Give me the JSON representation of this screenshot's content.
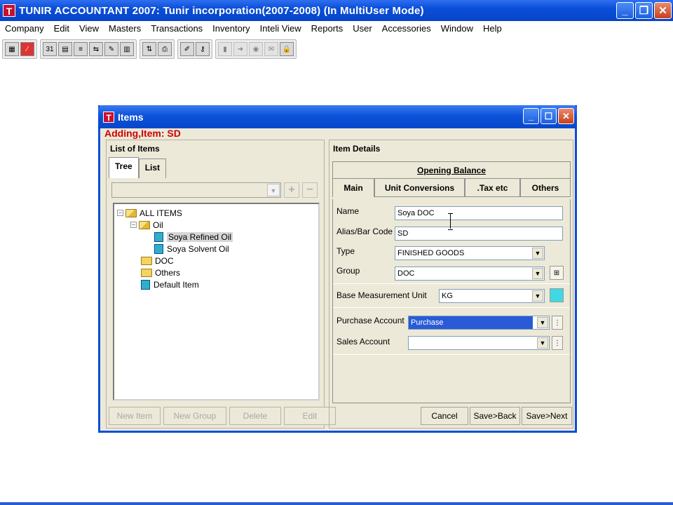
{
  "app": {
    "title": "TUNIR ACCOUNTANT 2007:  Tunir incorporation(2007-2008) (In MultiUser Mode)",
    "logo": "T"
  },
  "menu": [
    "Company",
    "Edit",
    "View",
    "Masters",
    "Transactions",
    "Inventory",
    "Inteli View",
    "Reports",
    "User",
    "Accessories",
    "Window",
    "Help"
  ],
  "dialog": {
    "title": "Items",
    "logo": "T",
    "status": "Adding,Item: SD",
    "left": {
      "title": "List of Items",
      "tabs": [
        "Tree",
        "List"
      ],
      "tree": [
        {
          "label": "ALL ITEMS",
          "icon": "folder-open-icon"
        },
        {
          "label": "Oil",
          "icon": "folder-open-icon"
        },
        {
          "label": "Soya Refined Oil",
          "icon": "item-icon",
          "selected": true
        },
        {
          "label": "Soya Solvent Oil",
          "icon": "item-icon"
        },
        {
          "label": "DOC",
          "icon": "folder-icon"
        },
        {
          "label": "Others",
          "icon": "folder-icon"
        },
        {
          "label": "Default Item",
          "icon": "item-icon"
        }
      ],
      "buttons": [
        "New Item",
        "New Group",
        "Delete",
        "Edit"
      ]
    },
    "right": {
      "title": "Item Details",
      "tabs_top": [
        "Opening Balance"
      ],
      "tabs": [
        "Main",
        "Unit Conversions",
        ".Tax etc",
        "Others"
      ],
      "fields": {
        "name_label": "Name",
        "name_value": "Soya DOC",
        "alias_label": "Alias/Bar Code",
        "alias_value": "SD",
        "type_label": "Type",
        "type_value": "FINISHED GOODS",
        "group_label": "Group",
        "group_value": "DOC",
        "unit_label": "Base Measurement Unit",
        "unit_value": "KG",
        "purchase_label": "Purchase Account",
        "purchase_value": "Purchase",
        "sales_label": "Sales Account",
        "sales_value": ""
      },
      "buttons": [
        "Cancel",
        "Save>Back",
        "Save>Next"
      ]
    }
  },
  "colors": {
    "titlebar": "#0a4fd8",
    "status": "#d00000",
    "selection": "#2a5bd7"
  }
}
